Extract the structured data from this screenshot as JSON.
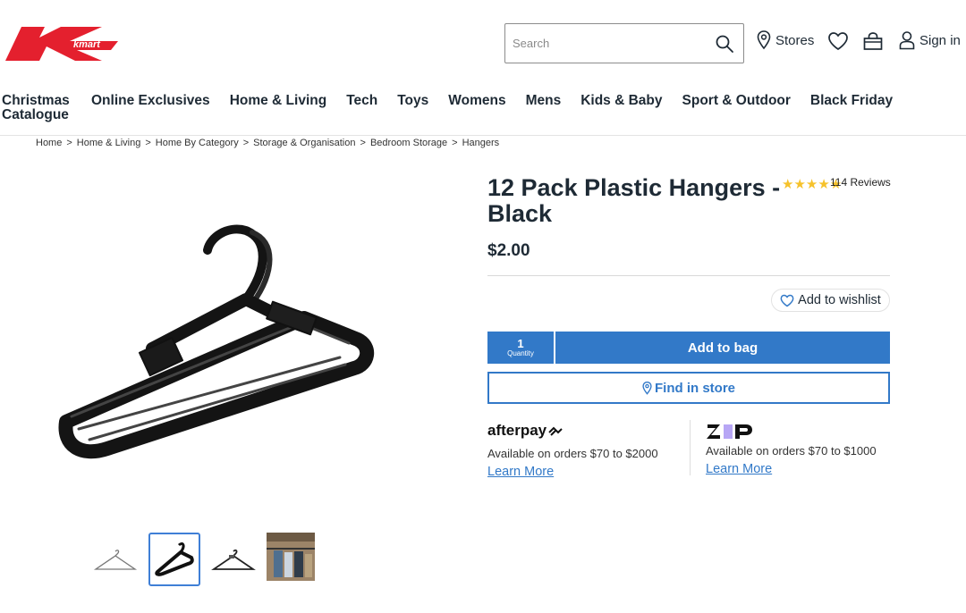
{
  "header": {
    "logo_text": "kmart",
    "search_placeholder": "Search",
    "stores_label": "Stores",
    "signin_label": "Sign in"
  },
  "nav": {
    "items": [
      "Christmas Catalogue",
      "Online Exclusives",
      "Home & Living",
      "Tech",
      "Toys",
      "Womens",
      "Mens",
      "Kids & Baby",
      "Sport & Outdoor",
      "Black Friday"
    ]
  },
  "breadcrumb": [
    "Home",
    "Home & Living",
    "Home By Category",
    "Storage & Organisation",
    "Bedroom Storage",
    "Hangers"
  ],
  "breadcrumb_sep": ">",
  "product": {
    "title": "12 Pack Plastic Hangers - Black",
    "rating_stars": "★★★★★",
    "reviews": "114 Reviews",
    "price": "$2.00",
    "wishlist_label": "Add to wishlist",
    "quantity": "1",
    "quantity_label": "Quantity",
    "add_to_bag_label": "Add to bag",
    "find_in_store_label": "Find in store"
  },
  "payments": {
    "afterpay": {
      "name": "afterpay",
      "avail": "Available on orders $70 to $2000",
      "learn": "Learn More"
    },
    "zip": {
      "name": "zip",
      "avail": "Available on orders $70 to $1000",
      "learn": "Learn More"
    }
  },
  "colors": {
    "brand_red": "#e4202e",
    "accent_blue": "#3279c8",
    "star_yellow": "#f6c22b",
    "text_dark": "#1e2a35"
  },
  "thumbnails": [
    "hanger-outline",
    "hanger-black",
    "hanger-black-outline",
    "hangers-in-wardrobe-photo"
  ]
}
